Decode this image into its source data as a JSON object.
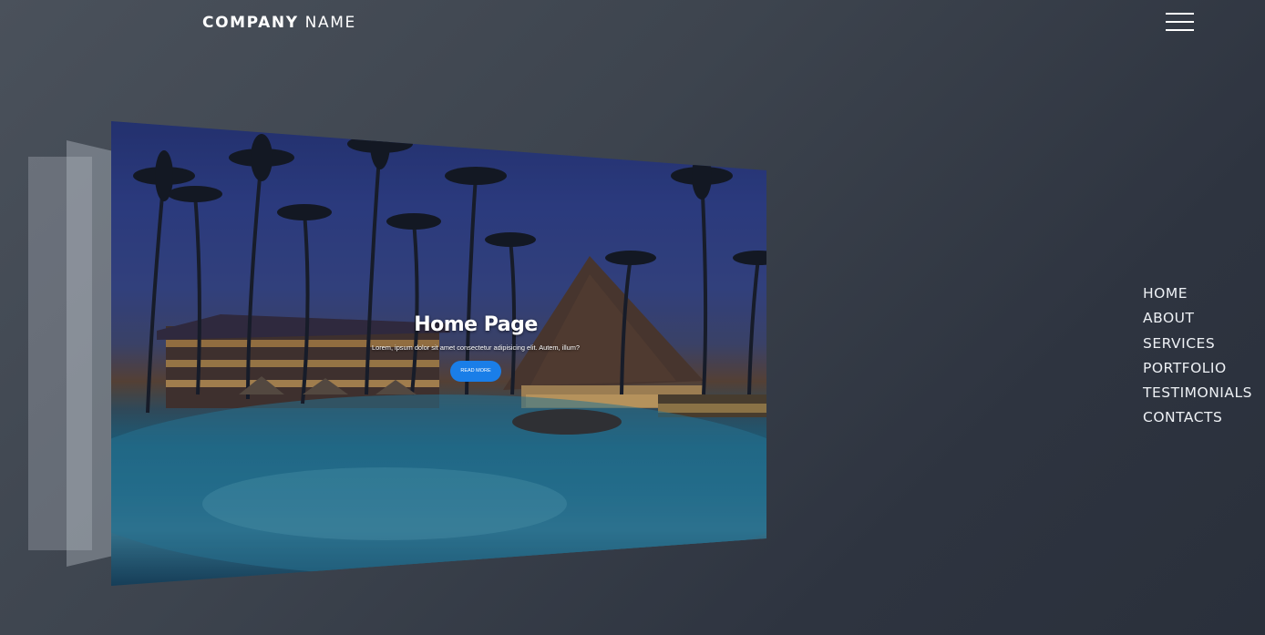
{
  "header": {
    "logo_bold": "COMPANY",
    "logo_light": " NAME",
    "menu_icon": "hamburger-menu-icon"
  },
  "slide": {
    "title": "Home Page",
    "text": "Lorem, ipsum dolor sit amet consectetur adipisicing elit. Autem, illum?",
    "button_label": "READ MORE",
    "button_color": "#1a7ee8",
    "image": "resort-pool-night-photo"
  },
  "nav": {
    "items": [
      {
        "label": "HOME"
      },
      {
        "label": "ABOUT"
      },
      {
        "label": "SERVICES"
      },
      {
        "label": "PORTFOLIO"
      },
      {
        "label": "TESTIMONIALS"
      },
      {
        "label": "CONTACTS"
      }
    ]
  }
}
